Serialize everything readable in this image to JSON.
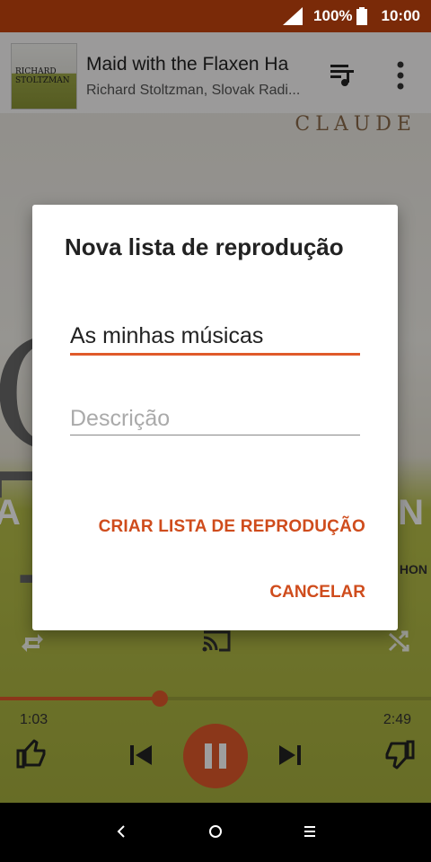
{
  "status_bar": {
    "battery": "100%",
    "clock": "10:00"
  },
  "now_playing": {
    "title": "Maid with the Flaxen Ha",
    "artist": "Richard Stoltzman, Slovak Radi...",
    "thumb_text": "RICHARD STOLTZMAN"
  },
  "album_art": {
    "top_word": "CLAUDE",
    "band_left": "A",
    "band_right": "N",
    "side_text": "HON"
  },
  "player": {
    "elapsed": "1:03",
    "total": "2:49",
    "progress": 0.37
  },
  "dialog": {
    "title": "Nova lista de reprodução",
    "name_value": "As minhas músicas",
    "description_placeholder": "Descrição",
    "create_label": "CRIAR LISTA DE REPRODUÇÃO",
    "cancel_label": "CANCELAR"
  },
  "colors": {
    "accent": "#e05a2a",
    "status_bar": "#7a2a08"
  },
  "icons": [
    "signal-icon",
    "battery-icon",
    "queue-icon",
    "more-vert-icon",
    "repeat-icon",
    "cast-icon",
    "shuffle-icon",
    "thumb-up-icon",
    "skip-previous-icon",
    "pause-icon",
    "skip-next-icon",
    "thumb-down-icon",
    "nav-back-icon",
    "nav-home-icon",
    "nav-recents-icon"
  ]
}
